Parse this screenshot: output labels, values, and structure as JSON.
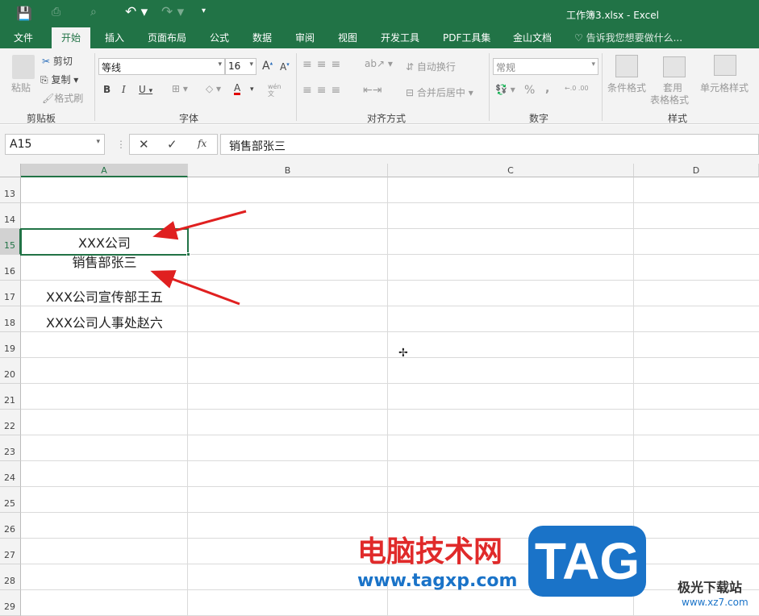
{
  "title": "工作簿3.xlsx - Excel",
  "qat": {
    "save": "save-icon",
    "undo": "undo-icon",
    "redo": "redo-icon"
  },
  "tabs": [
    "文件",
    "开始",
    "插入",
    "页面布局",
    "公式",
    "数据",
    "审阅",
    "视图",
    "开发工具",
    "PDF工具集",
    "金山文档"
  ],
  "tell_me": "告诉我您想要做什么...",
  "ribbon": {
    "clipboard": {
      "paste": "粘贴",
      "cut": "剪切",
      "copy": "复制",
      "format_painter": "格式刷",
      "label": "剪贴板"
    },
    "font": {
      "name": "等线",
      "size": "16",
      "bold": "B",
      "italic": "I",
      "underline": "U",
      "phonetic": "wén\n文",
      "label": "字体",
      "font_color": "#e00000"
    },
    "alignment": {
      "wrap": "自动换行",
      "merge": "合并后居中",
      "label": "对齐方式"
    },
    "number": {
      "format": "常规",
      "percent": "%",
      "comma": ",",
      "label": "数字"
    },
    "styles": {
      "conditional": "条件格式",
      "table1": "套用",
      "table2": "表格格式",
      "cell_styles": "单元格样式",
      "label": "样式"
    }
  },
  "formula_bar": {
    "name_box": "A15",
    "formula": "销售部张三",
    "fx": "fx"
  },
  "columns": [
    "A",
    "B",
    "C",
    "D"
  ],
  "rows": [
    "13",
    "14",
    "15",
    "16",
    "17",
    "18",
    "19",
    "20",
    "21",
    "22",
    "23",
    "24",
    "25",
    "26",
    "27",
    "28",
    "29"
  ],
  "cells": {
    "a15_line1": "XXX公司",
    "a15_line2": "销售部张三",
    "a17": "XXX公司宣传部王五",
    "a18": "XXX公司人事处赵六"
  },
  "watermark": {
    "site_cn": "电脑技术网",
    "site_url": "www.tagxp.com",
    "logo": "TAG",
    "site2": "极光下载站",
    "site2_url": "www.xz7.com"
  },
  "colors": {
    "brand": "#217346",
    "arrow": "#e02020",
    "watermark_red": "#e02a2a",
    "watermark_blue": "#1a73c8"
  }
}
